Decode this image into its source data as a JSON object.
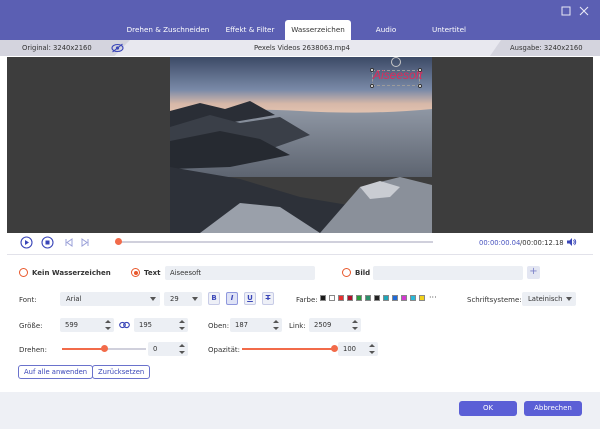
{
  "tabs": [
    {
      "label": "Drehen & Zuschneiden"
    },
    {
      "label": "Effekt & Filter"
    },
    {
      "label": "Wasserzeichen"
    },
    {
      "label": "Audio"
    },
    {
      "label": "Untertitel"
    }
  ],
  "info": {
    "original": "Original: 3240x2160",
    "filename": "Pexels Videos 2638063.mp4",
    "output": "Ausgabe: 3240x2160"
  },
  "watermark_preview_text": "Aiseesoft",
  "playback": {
    "current": "00:00:00.04",
    "total": "/00:00:12.18",
    "progress": 0.01
  },
  "mode": {
    "none_label": "Kein Wasserzeichen",
    "text_label": "Text",
    "text_value": "Aiseesoft",
    "image_label": "Bild",
    "selected": "text"
  },
  "font": {
    "label": "Font:",
    "family": "Arial",
    "size": "29",
    "bold": "B",
    "italic": "I",
    "underline": "U",
    "strike": "T",
    "color_label": "Farbe:",
    "more_colors": "···",
    "script_label": "Schriftsysteme:",
    "script_value": "Lateinisch"
  },
  "colors": [
    "#1a1a1a",
    "#ffffff",
    "#e83030",
    "#b0102a",
    "#2a9a3a",
    "#2b8f6a",
    "#222222",
    "#1fa6b8",
    "#1f6ad8",
    "#d23ad0",
    "#2ab8d8",
    "#f2d21a"
  ],
  "size": {
    "label": "Größe:",
    "width": "599",
    "height": "195",
    "top_label": "Oben:",
    "top": "187",
    "left_label": "Link:",
    "left": "2509"
  },
  "rotate": {
    "label": "Drehen:",
    "value": "0",
    "fraction": 0.5
  },
  "opacity": {
    "label": "Opazität:",
    "value": "100",
    "fraction": 1.0
  },
  "buttons": {
    "apply_all": "Auf alle anwenden",
    "reset": "Zurücksetzen",
    "ok": "OK",
    "cancel": "Abbrechen"
  },
  "accent": "#5b5fd6",
  "slider_color": "#f26b4a"
}
